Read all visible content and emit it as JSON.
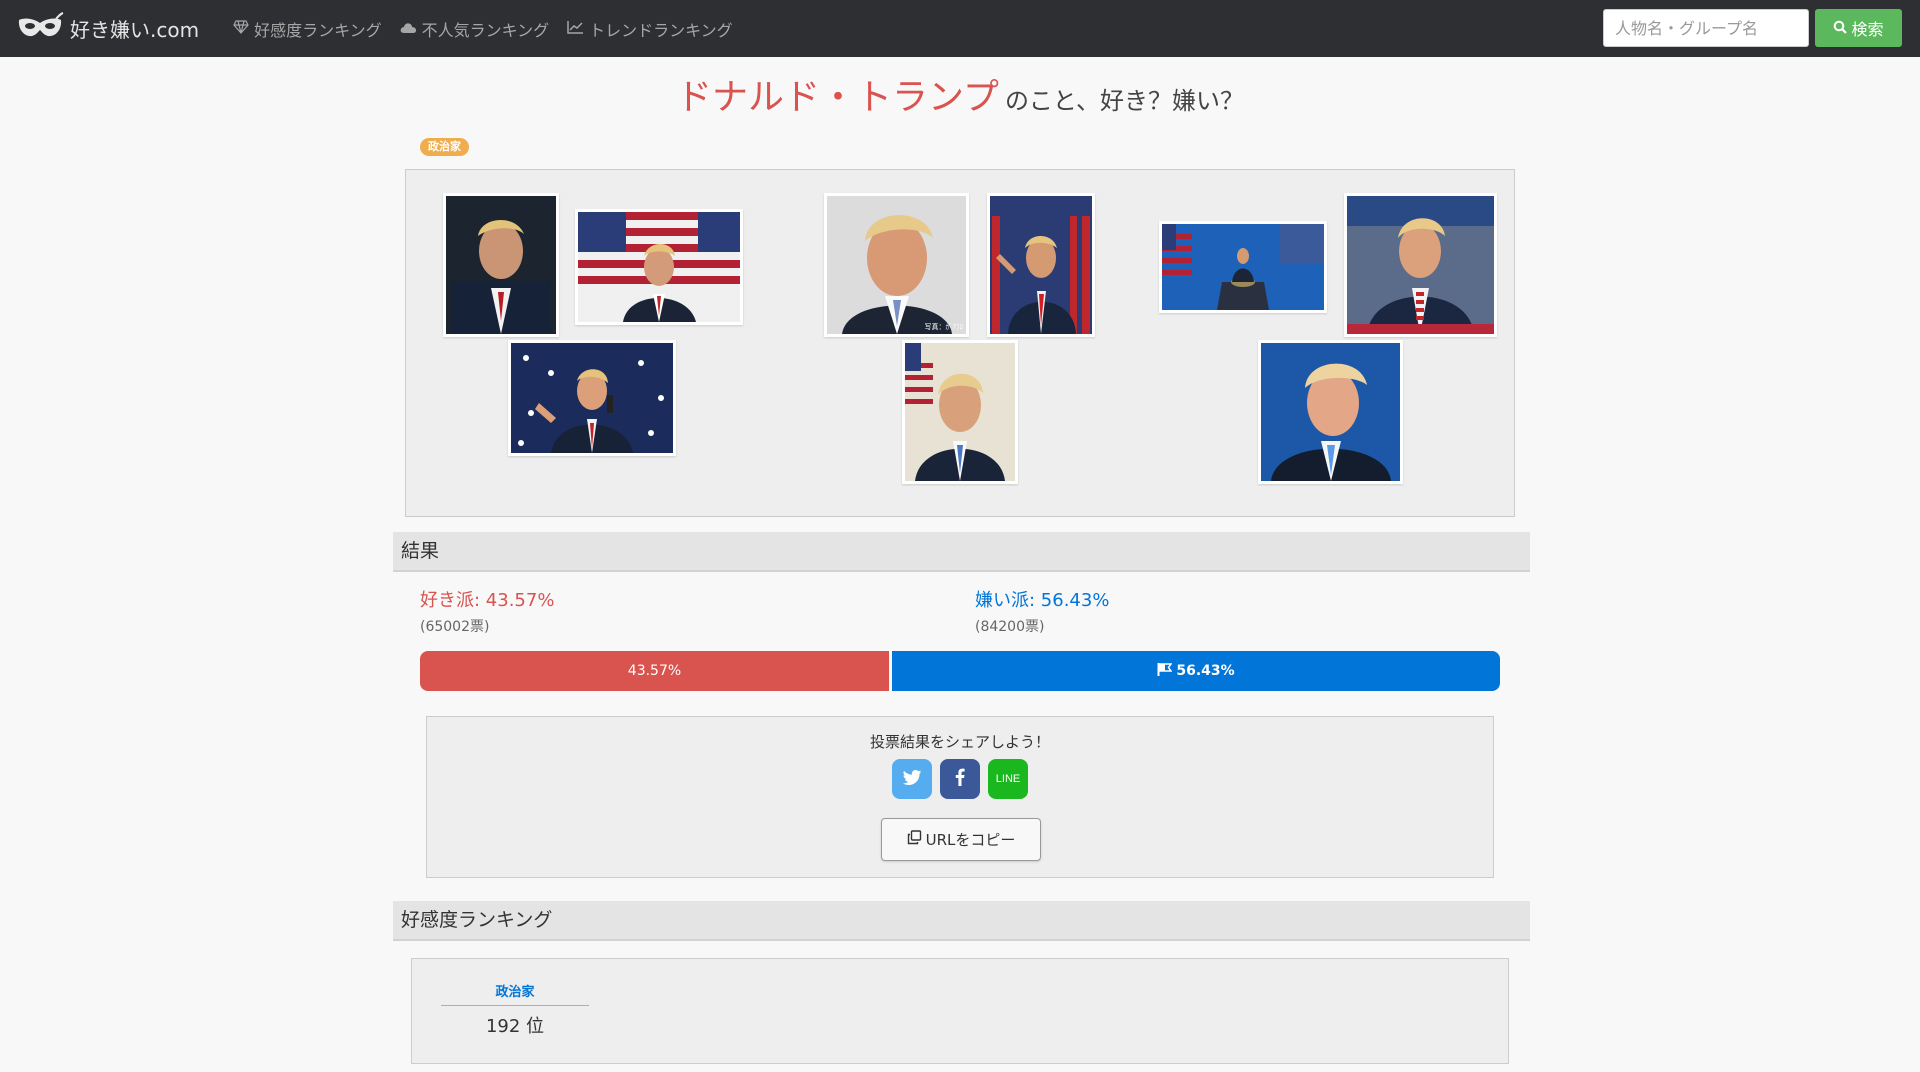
{
  "nav": {
    "brand": "好き嫌い.com",
    "links": [
      {
        "label": "好感度ランキング",
        "icon": "diamond-icon"
      },
      {
        "label": "不人気ランキング",
        "icon": "cloud-icon"
      },
      {
        "label": "トレンドランキング",
        "icon": "line-chart-icon"
      }
    ],
    "search_placeholder": "人物名・グループ名",
    "search_button": "検索"
  },
  "person": {
    "name": "ドナルド・トランプ",
    "suffix": "のこと、好き？嫌い？",
    "category": "政治家"
  },
  "gallery": {
    "credit": "写真：ｶﾞｱﾌﾛ"
  },
  "result": {
    "heading": "結果",
    "like_label": "好き派",
    "like_percent": "43.57%",
    "like_votes": "(65002票)",
    "dislike_label": "嫌い派",
    "dislike_percent": "56.43%",
    "dislike_votes": "(84200票)",
    "like_fraction": 0.4357,
    "colors": {
      "like": "#d9534f",
      "dislike": "#0275d8"
    }
  },
  "share": {
    "prompt": "投票結果をシェアしよう！",
    "buttons": [
      {
        "name": "twitter",
        "icon": "twitter-icon"
      },
      {
        "name": "facebook",
        "icon": "facebook-icon"
      },
      {
        "name": "line",
        "label": "LINE"
      }
    ],
    "copy_label": "URLをコピー"
  },
  "ranking": {
    "heading": "好感度ランキング",
    "category": "政治家",
    "rank": "192 位"
  }
}
